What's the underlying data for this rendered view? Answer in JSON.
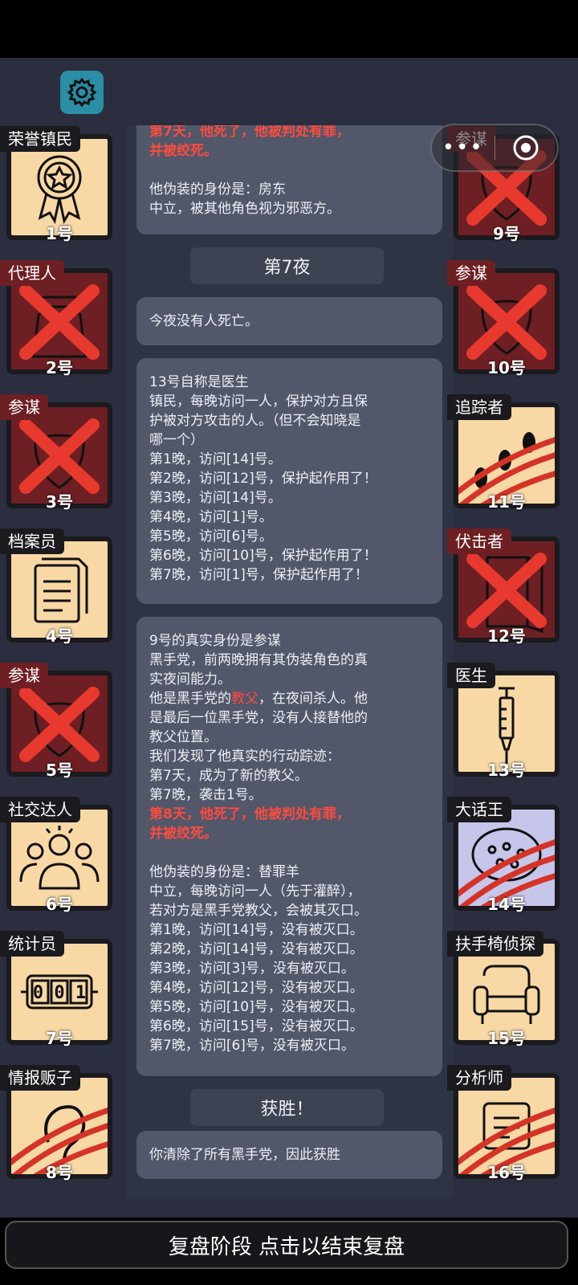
{
  "capsule": {
    "more_glyph": "•••"
  },
  "log_cards": {
    "card0": [
      "第7天，他死了，他被判处有罪，",
      "并被绞死。",
      "",
      "他伪装的身份是：房东",
      "中立，被其他角色视为邪恶方。"
    ],
    "night_header": "第7夜",
    "card1": [
      "今夜没有人死亡。"
    ],
    "card2": [
      "13号自称是医生",
      "镇民，每晚访问一人，保护对方且保",
      "护被对方攻击的人。（但不会知晓是",
      "哪一个）",
      "第1晚，访问[14]号。",
      "第2晚，访问[12]号，保护起作用了！",
      "第3晚，访问[14]号。",
      "第4晚，访问[1]号。",
      "第5晚，访问[6]号。",
      "第6晚，访问[10]号，保护起作用了！",
      "第7晚，访问[1]号，保护起作用了！"
    ],
    "card3": {
      "l1": "9号的真实身份是参谋",
      "l2": "黑手党，前两晚拥有其伪装角色的真",
      "l3": "实夜间能力。",
      "l4a": "他是黑手党的",
      "l4b": "教父",
      "l4c": "，在夜间杀人。他",
      "l5": "是最后一位黑手党，没有人接替他的",
      "l6": "教父位置。",
      "l7": "我们发现了他真实的行动踪迹：",
      "l8": "第7天，成为了新的教父。",
      "l9": "第7晚，袭击1号。",
      "l10": "第8天，他死了，他被判处有罪，",
      "l11": "并被绞死。",
      "l12": "他伪装的身份是：替罪羊",
      "l13": "中立，每晚访问一人（先于灌醉），",
      "l14": "若对方是黑手党教父，会被其灭口。",
      "l15": "第1晚，访问[14]号，没有被灭口。",
      "l16": "第2晚，访问[14]号，没有被灭口。",
      "l17": "第3晚，访问[3]号，没有被灭口。",
      "l18": "第4晚，访问[12]号，没有被灭口。",
      "l19": "第5晚，访问[10]号，没有被灭口。",
      "l20": "第6晚，访问[15]号，没有被灭口。",
      "l21": "第7晚，访问[6]号，没有被灭口。"
    },
    "victory_header": "获胜！",
    "card4": [
      "你清除了所有黑手党，因此获胜"
    ]
  },
  "players": [
    {
      "id": "1号",
      "role": "荣誉镇民",
      "status": "alive",
      "icon": "medal-icon"
    },
    {
      "id": "2号",
      "role": "代理人",
      "status": "dead",
      "icon": "agent-coat-icon"
    },
    {
      "id": "3号",
      "role": "参谋",
      "status": "dead",
      "icon": "mask-icon"
    },
    {
      "id": "4号",
      "role": "档案员",
      "status": "alive",
      "icon": "documents-icon"
    },
    {
      "id": "5号",
      "role": "参谋",
      "status": "dead",
      "icon": "mask-icon"
    },
    {
      "id": "6号",
      "role": "社交达人",
      "status": "alive",
      "icon": "people-group-icon"
    },
    {
      "id": "7号",
      "role": "统计员",
      "status": "alive",
      "icon": "counter-icon",
      "counter": "001"
    },
    {
      "id": "8号",
      "role": "情报贩子",
      "status": "scratched",
      "icon": "ear-icon"
    },
    {
      "id": "9号",
      "role": "参谋",
      "status": "dead",
      "icon": "mask-icon"
    },
    {
      "id": "10号",
      "role": "参谋",
      "status": "dead",
      "icon": "mask-icon"
    },
    {
      "id": "11号",
      "role": "追踪者",
      "status": "scratched",
      "icon": "footprints-icon"
    },
    {
      "id": "12号",
      "role": "伏击者",
      "status": "dead",
      "icon": "door-icon"
    },
    {
      "id": "13号",
      "role": "医生",
      "status": "alive",
      "icon": "syringe-icon"
    },
    {
      "id": "14号",
      "role": "大话王",
      "status": "scratched-suspect",
      "icon": "speech-bubble-icon"
    },
    {
      "id": "15号",
      "role": "扶手椅侦探",
      "status": "alive",
      "icon": "armchair-icon"
    },
    {
      "id": "16号",
      "role": "分析师",
      "status": "scratched",
      "icon": "analyst-icon"
    }
  ],
  "footer": {
    "label": "复盘阶段 点击以结束复盘"
  },
  "colors": {
    "background": "#2a2e3e",
    "card": "#52576a",
    "tile_alive": "#f8d8a5",
    "tile_dead": "#6e1f23",
    "cross": "#e8392e",
    "highlight": "#ff4b3e",
    "settings": "#2a8ea6"
  }
}
